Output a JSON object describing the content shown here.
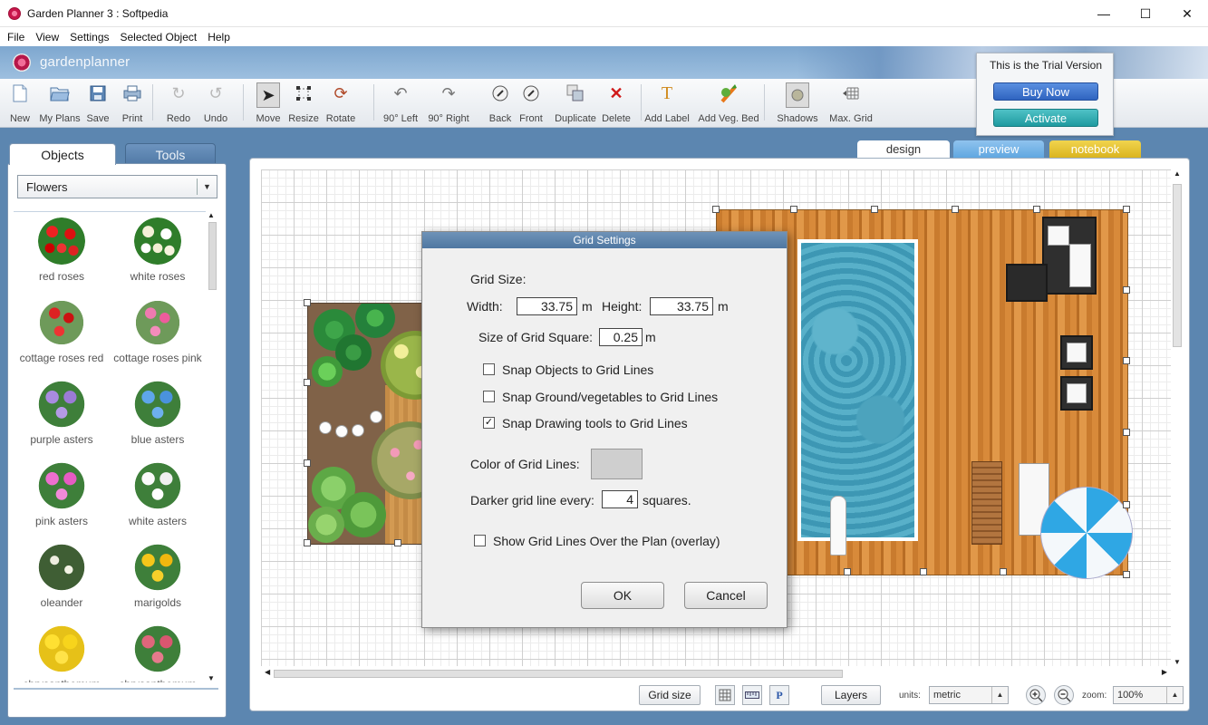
{
  "window": {
    "title": "Garden Planner 3 : Softpedia",
    "minimize": "—",
    "maximize": "☐",
    "close": "✕"
  },
  "menu": [
    "File",
    "View",
    "Settings",
    "Selected Object",
    "Help"
  ],
  "brand": {
    "name": "gardenplanner"
  },
  "toolbar": {
    "new": "New",
    "my_plans": "My Plans",
    "save": "Save",
    "print": "Print",
    "redo": "Redo",
    "undo": "Undo",
    "move": "Move",
    "resize": "Resize",
    "rotate": "Rotate",
    "rot_left": "90° Left",
    "rot_right": "90° Right",
    "back": "Back",
    "front": "Front",
    "duplicate": "Duplicate",
    "delete": "Delete",
    "add_label": "Add Label",
    "add_veg_bed": "Add Veg. Bed",
    "shadows": "Shadows",
    "max_grid": "Max. Grid"
  },
  "trial": {
    "title": "This is the Trial Version",
    "buy": "Buy Now",
    "activate": "Activate"
  },
  "left_panel": {
    "tab_objects": "Objects",
    "tab_tools": "Tools",
    "category": "Flowers",
    "plants": [
      {
        "name": "red roses"
      },
      {
        "name": "white roses"
      },
      {
        "name": "cottage roses red"
      },
      {
        "name": "cottage roses pink"
      },
      {
        "name": "purple asters"
      },
      {
        "name": "blue asters"
      },
      {
        "name": "pink asters"
      },
      {
        "name": "white asters"
      },
      {
        "name": "oleander"
      },
      {
        "name": "marigolds"
      },
      {
        "name": "chrysanthemum"
      },
      {
        "name": "chrysanthemum"
      }
    ]
  },
  "view_tabs": {
    "design": "design",
    "preview": "preview",
    "notebook": "notebook"
  },
  "statusbar": {
    "grid_size": "Grid size",
    "layers": "Layers",
    "units_label": "units:",
    "units_value": "metric",
    "zoom_label": "zoom:",
    "zoom_value": "100%",
    "p_icon": "P"
  },
  "dialog": {
    "title": "Grid Settings",
    "grid_size_label": "Grid Size:",
    "width_label": "Width:",
    "width_value": "33.75",
    "width_unit": "m",
    "height_label": "Height:",
    "height_value": "33.75",
    "height_unit": "m",
    "square_label": "Size of Grid Square:",
    "square_value": "0.25",
    "square_unit": "m",
    "snap_objects": "Snap Objects to Grid Lines",
    "snap_objects_checked": false,
    "snap_ground": "Snap Ground/vegetables to Grid Lines",
    "snap_ground_checked": false,
    "snap_drawing": "Snap Drawing tools to Grid Lines",
    "snap_drawing_checked": true,
    "color_label": "Color of Grid Lines:",
    "color_value": "#cfcfcf",
    "darker_label": "Darker grid line every:",
    "darker_value": "4",
    "darker_unit": "squares.",
    "overlay_label": "Show Grid Lines Over the Plan (overlay)",
    "overlay_checked": false,
    "ok": "OK",
    "cancel": "Cancel"
  }
}
